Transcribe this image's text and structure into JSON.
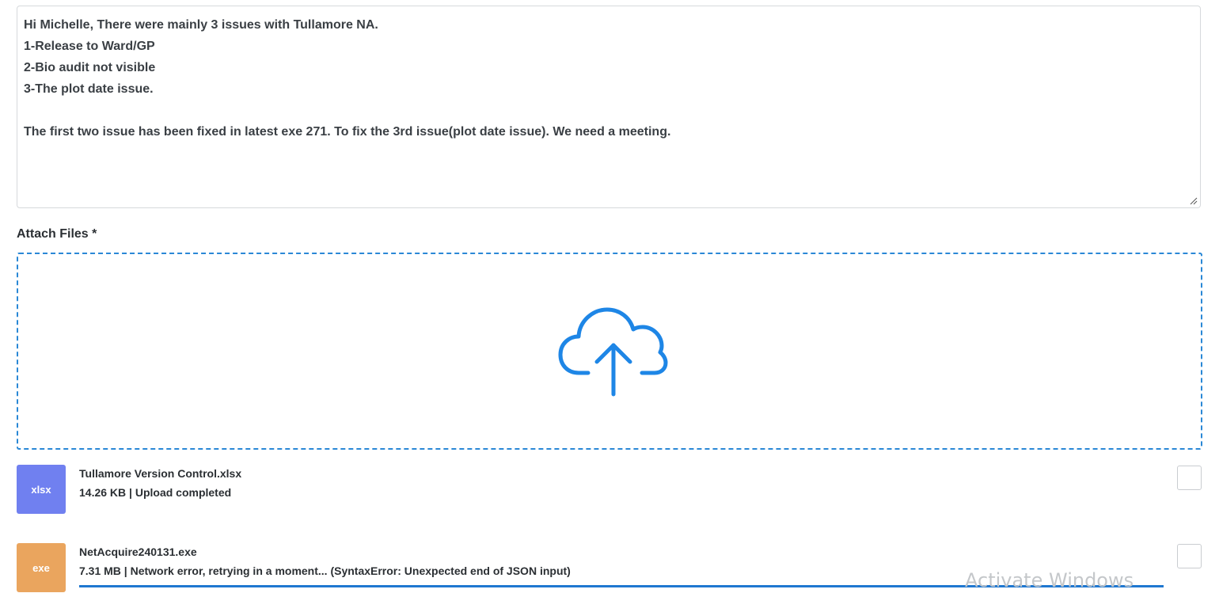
{
  "message": {
    "lines": [
      "Hi Michelle, There were mainly 3 issues with Tullamore NA.",
      "1-Release to Ward/GP",
      "2-Bio audit not visible",
      "3-The plot date issue.",
      "",
      "The first two issue has been fixed in latest exe 271. To fix the 3rd issue(plot date issue). We need a meeting."
    ]
  },
  "attach": {
    "label": "Attach Files *",
    "dropzone_icon": "cloud-upload-icon",
    "accent_color": "#2a88d6"
  },
  "files": [
    {
      "thumb": "xlsx",
      "thumb_color": "#7080f0",
      "name": "Tullamore Version Control.xlsx",
      "status": "14.26 KB | Upload completed"
    },
    {
      "thumb": "exe",
      "thumb_color": "#eaa55e",
      "name": "NetAcquire240131.exe",
      "status": "7.31 MB | Network error, retrying in a moment... (SyntaxError: Unexpected end of JSON input)",
      "progress": 1.0
    }
  ],
  "watermark": "Activate Windows"
}
